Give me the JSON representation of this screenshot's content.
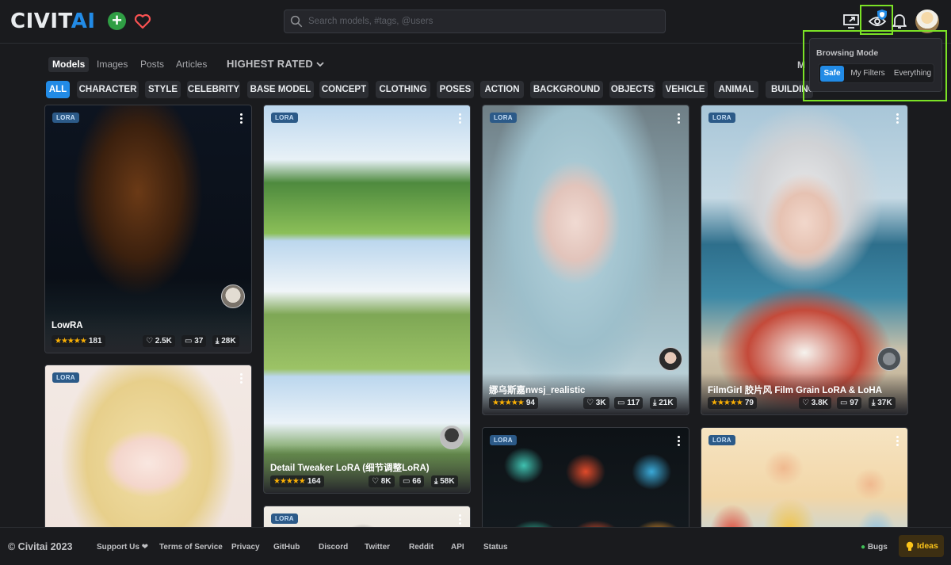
{
  "header": {
    "logo_part1": "CIVIT",
    "logo_part2": "AI",
    "search_placeholder": "Search models, #tags, @users"
  },
  "browsing_mode": {
    "title": "Browsing Mode",
    "options": [
      "Safe",
      "My Filters",
      "Everything"
    ],
    "selected": "Safe"
  },
  "content_tabs": [
    "Models",
    "Images",
    "Posts",
    "Articles"
  ],
  "active_tab": "Models",
  "sort": {
    "label": "HIGHEST RATED",
    "right_partial": "M"
  },
  "categories": [
    "ALL",
    "CHARACTER",
    "STYLE",
    "CELEBRITY",
    "BASE MODEL",
    "CONCEPT",
    "CLOTHING",
    "POSES",
    "ACTION",
    "BACKGROUND",
    "OBJECTS",
    "VEHICLE",
    "ANIMAL",
    "BUILDING"
  ],
  "cards": [
    {
      "badge": "LORA",
      "title": "LowRA",
      "stars": "★★★★★",
      "rating_count": "181",
      "likes": "2.5K",
      "comments": "37",
      "downloads": "28K"
    },
    {
      "badge": "LORA",
      "title": "Detail Tweaker LoRA (细节调整LoRA)",
      "stars": "★★★★★",
      "rating_count": "164",
      "likes": "8K",
      "comments": "66",
      "downloads": "58K"
    },
    {
      "badge": "LORA",
      "title": "娜乌斯嘉nwsj_realistic",
      "stars": "★★★★★",
      "rating_count": "94",
      "likes": "3K",
      "comments": "117",
      "downloads": "21K"
    },
    {
      "badge": "LORA",
      "title": "FilmGirl 胶片风 Film Grain LoRA & LoHA",
      "stars": "★★★★★",
      "rating_count": "79",
      "likes": "3.8K",
      "comments": "97",
      "downloads": "37K"
    },
    {
      "badge": "LORA"
    },
    {
      "badge": "LORA"
    },
    {
      "badge": "LORA"
    },
    {
      "badge": "LORA"
    }
  ],
  "footer": {
    "copyright": "© Civitai 2023",
    "links": [
      "Support Us ❤",
      "Terms of Service",
      "Privacy",
      "GitHub",
      "Discord",
      "Twitter",
      "Reddit",
      "API",
      "Status"
    ],
    "bugs": "Bugs",
    "ideas": "Ideas"
  },
  "colors": {
    "accent": "#228be6",
    "brand_blue": "#228be6",
    "highlight": "#7be226",
    "star": "#fab005"
  }
}
